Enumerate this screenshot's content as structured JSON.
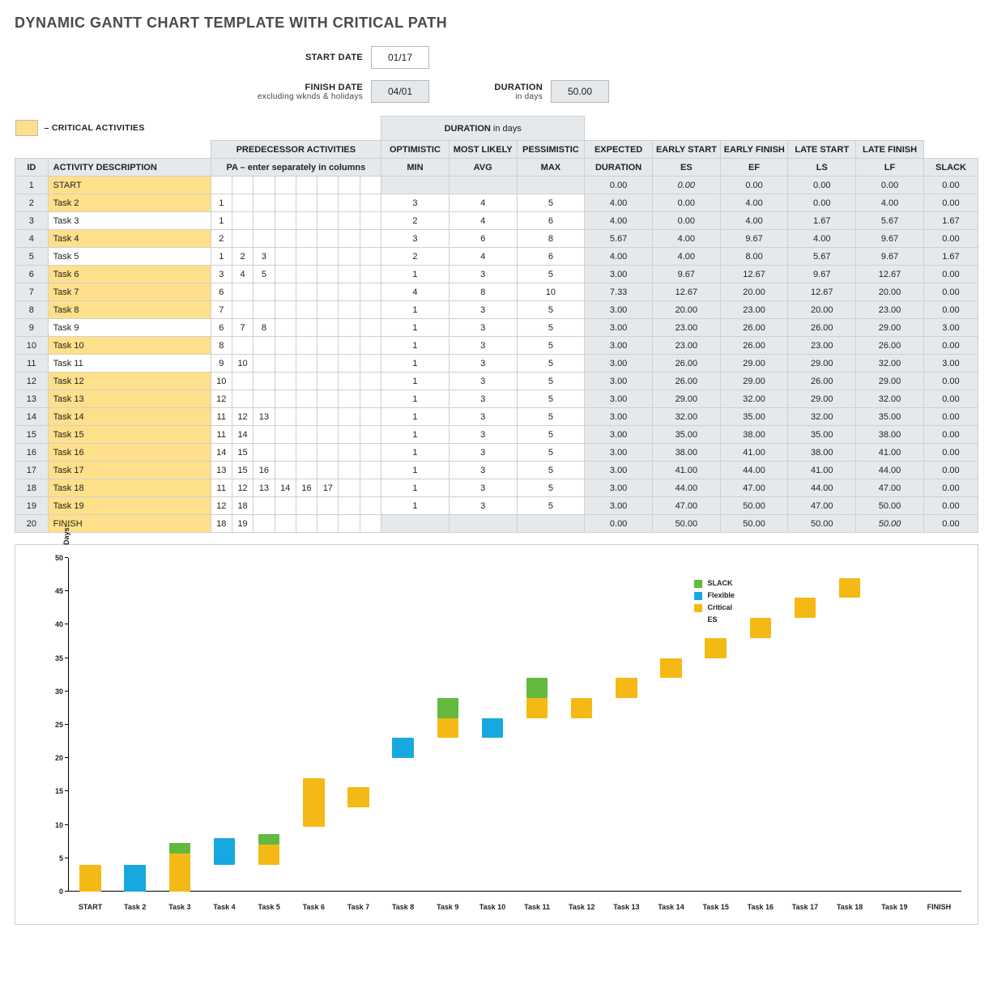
{
  "title": "DYNAMIC GANTT CHART TEMPLATE WITH CRITICAL PATH",
  "form": {
    "startLabel": "START DATE",
    "startValue": "01/17",
    "finishLabel": "FINISH DATE",
    "finishSub": "excluding wknds & holidays",
    "finishValue": "04/01",
    "durLabel": "DURATION",
    "durSub": "in days",
    "durValue": "50.00"
  },
  "legend": {
    "text": "– CRITICAL ACTIVITIES"
  },
  "headers": {
    "predGroup": "PREDECESSOR ACTIVITIES",
    "predSub": "PA  –  enter separately in columns",
    "durGroup1": "DURATION",
    "durGroup2": " in days",
    "opt": "OPTIMISTIC",
    "most": "MOST LIKELY",
    "pess": "PESSIMISTIC",
    "min": "MIN",
    "avg": "AVG",
    "max": "MAX",
    "exp": "EXPECTED",
    "es": "EARLY START",
    "ef": "EARLY FINISH",
    "ls": "LATE START",
    "lf": "LATE FINISH",
    "dur": "DURATION",
    "esS": "ES",
    "efS": "EF",
    "lsS": "LS",
    "lfS": "LF",
    "slack": "SLACK",
    "id": "ID",
    "activity": "ACTIVITY DESCRIPTION"
  },
  "predCols": 8,
  "rows": [
    {
      "id": 1,
      "name": "START",
      "crit": true,
      "pred": [],
      "min": "",
      "avg": "",
      "max": "",
      "dur": "0.00",
      "es": "0.00",
      "ef": "0.00",
      "ls": "0.00",
      "lf": "0.00",
      "slack": "0.00",
      "ital": [
        "es"
      ]
    },
    {
      "id": 2,
      "name": "Task 2",
      "crit": true,
      "pred": [
        "1"
      ],
      "min": "3",
      "avg": "4",
      "max": "5",
      "dur": "4.00",
      "es": "0.00",
      "ef": "4.00",
      "ls": "0.00",
      "lf": "4.00",
      "slack": "0.00"
    },
    {
      "id": 3,
      "name": "Task 3",
      "crit": false,
      "pred": [
        "1"
      ],
      "min": "2",
      "avg": "4",
      "max": "6",
      "dur": "4.00",
      "es": "0.00",
      "ef": "4.00",
      "ls": "1.67",
      "lf": "5.67",
      "slack": "1.67"
    },
    {
      "id": 4,
      "name": "Task 4",
      "crit": true,
      "pred": [
        "2"
      ],
      "min": "3",
      "avg": "6",
      "max": "8",
      "dur": "5.67",
      "es": "4.00",
      "ef": "9.67",
      "ls": "4.00",
      "lf": "9.67",
      "slack": "0.00"
    },
    {
      "id": 5,
      "name": "Task 5",
      "crit": false,
      "pred": [
        "1",
        "2",
        "3"
      ],
      "min": "2",
      "avg": "4",
      "max": "6",
      "dur": "4.00",
      "es": "4.00",
      "ef": "8.00",
      "ls": "5.67",
      "lf": "9.67",
      "slack": "1.67"
    },
    {
      "id": 6,
      "name": "Task 6",
      "crit": true,
      "pred": [
        "3",
        "4",
        "5"
      ],
      "min": "1",
      "avg": "3",
      "max": "5",
      "dur": "3.00",
      "es": "9.67",
      "ef": "12.67",
      "ls": "9.67",
      "lf": "12.67",
      "slack": "0.00"
    },
    {
      "id": 7,
      "name": "Task 7",
      "crit": true,
      "pred": [
        "6"
      ],
      "min": "4",
      "avg": "8",
      "max": "10",
      "dur": "7.33",
      "es": "12.67",
      "ef": "20.00",
      "ls": "12.67",
      "lf": "20.00",
      "slack": "0.00"
    },
    {
      "id": 8,
      "name": "Task 8",
      "crit": true,
      "pred": [
        "7"
      ],
      "min": "1",
      "avg": "3",
      "max": "5",
      "dur": "3.00",
      "es": "20.00",
      "ef": "23.00",
      "ls": "20.00",
      "lf": "23.00",
      "slack": "0.00"
    },
    {
      "id": 9,
      "name": "Task 9",
      "crit": false,
      "pred": [
        "6",
        "7",
        "8"
      ],
      "min": "1",
      "avg": "3",
      "max": "5",
      "dur": "3.00",
      "es": "23.00",
      "ef": "26.00",
      "ls": "26.00",
      "lf": "29.00",
      "slack": "3.00"
    },
    {
      "id": 10,
      "name": "Task 10",
      "crit": true,
      "pred": [
        "8"
      ],
      "min": "1",
      "avg": "3",
      "max": "5",
      "dur": "3.00",
      "es": "23.00",
      "ef": "26.00",
      "ls": "23.00",
      "lf": "26.00",
      "slack": "0.00"
    },
    {
      "id": 11,
      "name": "Task 11",
      "crit": false,
      "pred": [
        "9",
        "10"
      ],
      "min": "1",
      "avg": "3",
      "max": "5",
      "dur": "3.00",
      "es": "26.00",
      "ef": "29.00",
      "ls": "29.00",
      "lf": "32.00",
      "slack": "3.00"
    },
    {
      "id": 12,
      "name": "Task 12",
      "crit": true,
      "pred": [
        "10"
      ],
      "min": "1",
      "avg": "3",
      "max": "5",
      "dur": "3.00",
      "es": "26.00",
      "ef": "29.00",
      "ls": "26.00",
      "lf": "29.00",
      "slack": "0.00"
    },
    {
      "id": 13,
      "name": "Task 13",
      "crit": true,
      "pred": [
        "12"
      ],
      "min": "1",
      "avg": "3",
      "max": "5",
      "dur": "3.00",
      "es": "29.00",
      "ef": "32.00",
      "ls": "29.00",
      "lf": "32.00",
      "slack": "0.00"
    },
    {
      "id": 14,
      "name": "Task 14",
      "crit": true,
      "pred": [
        "11",
        "12",
        "13"
      ],
      "min": "1",
      "avg": "3",
      "max": "5",
      "dur": "3.00",
      "es": "32.00",
      "ef": "35.00",
      "ls": "32.00",
      "lf": "35.00",
      "slack": "0.00"
    },
    {
      "id": 15,
      "name": "Task 15",
      "crit": true,
      "pred": [
        "11",
        "14"
      ],
      "min": "1",
      "avg": "3",
      "max": "5",
      "dur": "3.00",
      "es": "35.00",
      "ef": "38.00",
      "ls": "35.00",
      "lf": "38.00",
      "slack": "0.00"
    },
    {
      "id": 16,
      "name": "Task 16",
      "crit": true,
      "pred": [
        "14",
        "15"
      ],
      "min": "1",
      "avg": "3",
      "max": "5",
      "dur": "3.00",
      "es": "38.00",
      "ef": "41.00",
      "ls": "38.00",
      "lf": "41.00",
      "slack": "0.00"
    },
    {
      "id": 17,
      "name": "Task 17",
      "crit": true,
      "pred": [
        "13",
        "15",
        "16"
      ],
      "min": "1",
      "avg": "3",
      "max": "5",
      "dur": "3.00",
      "es": "41.00",
      "ef": "44.00",
      "ls": "41.00",
      "lf": "44.00",
      "slack": "0.00"
    },
    {
      "id": 18,
      "name": "Task 18",
      "crit": true,
      "pred": [
        "11",
        "12",
        "13",
        "14",
        "16",
        "17"
      ],
      "min": "1",
      "avg": "3",
      "max": "5",
      "dur": "3.00",
      "es": "44.00",
      "ef": "47.00",
      "ls": "44.00",
      "lf": "47.00",
      "slack": "0.00"
    },
    {
      "id": 19,
      "name": "Task 19",
      "crit": true,
      "pred": [
        "12",
        "18"
      ],
      "min": "1",
      "avg": "3",
      "max": "5",
      "dur": "3.00",
      "es": "47.00",
      "ef": "50.00",
      "ls": "47.00",
      "lf": "50.00",
      "slack": "0.00"
    },
    {
      "id": 20,
      "name": "FINISH",
      "crit": true,
      "pred": [
        "18",
        "19"
      ],
      "min": "",
      "avg": "",
      "max": "",
      "dur": "0.00",
      "es": "50.00",
      "ef": "50.00",
      "ls": "50.00",
      "lf": "50.00",
      "slack": "0.00",
      "ital": [
        "lf"
      ]
    }
  ],
  "chart_data": {
    "type": "bar",
    "ylabel": "Days:",
    "ylim": [
      0,
      50
    ],
    "yticks": [
      0,
      5,
      10,
      15,
      20,
      25,
      30,
      35,
      40,
      45,
      50
    ],
    "categories": [
      "START",
      "Task 2",
      "Task 3",
      "Task 4",
      "Task 5",
      "Task 6",
      "Task 7",
      "Task 8",
      "Task 9",
      "Task 10",
      "Task 11",
      "Task 12",
      "Task 13",
      "Task 14",
      "Task 15",
      "Task 16",
      "Task 17",
      "Task 18",
      "Task 19",
      "FINISH"
    ],
    "legend": [
      "SLACK",
      "Flexible",
      "Critical",
      "ES"
    ],
    "colors": {
      "SLACK": "#62b93e",
      "Flexible": "#18a8e0",
      "Critical": "#f5b915",
      "ES": "#ffffff"
    },
    "bars": [
      {
        "i": 0,
        "segments": [
          {
            "kind": "crit",
            "from": 0,
            "to": 4
          }
        ]
      },
      {
        "i": 1,
        "segments": [
          {
            "kind": "flex",
            "from": 0,
            "to": 4
          }
        ]
      },
      {
        "i": 2,
        "segments": [
          {
            "kind": "crit",
            "from": 0,
            "to": 5.67
          },
          {
            "kind": "slack",
            "from": 5.67,
            "to": 7.34
          }
        ]
      },
      {
        "i": 3,
        "segments": [
          {
            "kind": "flex",
            "from": 4,
            "to": 8
          }
        ]
      },
      {
        "i": 4,
        "segments": [
          {
            "kind": "crit",
            "from": 4,
            "to": 7
          },
          {
            "kind": "slack",
            "from": 7,
            "to": 8.67
          }
        ]
      },
      {
        "i": 5,
        "segments": [
          {
            "kind": "crit",
            "from": 9.67,
            "to": 17
          }
        ]
      },
      {
        "i": 6,
        "segments": [
          {
            "kind": "crit",
            "from": 12.67,
            "to": 15.67
          }
        ]
      },
      {
        "i": 7,
        "segments": [
          {
            "kind": "flex",
            "from": 20,
            "to": 23
          }
        ]
      },
      {
        "i": 8,
        "segments": [
          {
            "kind": "crit",
            "from": 23,
            "to": 26
          },
          {
            "kind": "slack",
            "from": 26,
            "to": 29
          }
        ]
      },
      {
        "i": 9,
        "segments": [
          {
            "kind": "flex",
            "from": 23,
            "to": 26
          }
        ]
      },
      {
        "i": 10,
        "segments": [
          {
            "kind": "crit",
            "from": 26,
            "to": 29
          },
          {
            "kind": "slack",
            "from": 29,
            "to": 32
          }
        ]
      },
      {
        "i": 11,
        "segments": [
          {
            "kind": "crit",
            "from": 26,
            "to": 29
          }
        ]
      },
      {
        "i": 12,
        "segments": [
          {
            "kind": "crit",
            "from": 29,
            "to": 32
          }
        ]
      },
      {
        "i": 13,
        "segments": [
          {
            "kind": "crit",
            "from": 32,
            "to": 35
          }
        ]
      },
      {
        "i": 14,
        "segments": [
          {
            "kind": "crit",
            "from": 35,
            "to": 38
          }
        ]
      },
      {
        "i": 15,
        "segments": [
          {
            "kind": "crit",
            "from": 38,
            "to": 41
          }
        ]
      },
      {
        "i": 16,
        "segments": [
          {
            "kind": "crit",
            "from": 41,
            "to": 44
          }
        ]
      },
      {
        "i": 17,
        "segments": [
          {
            "kind": "crit",
            "from": 44,
            "to": 47
          }
        ]
      },
      {
        "i": 18,
        "segments": []
      },
      {
        "i": 19,
        "segments": []
      }
    ]
  }
}
